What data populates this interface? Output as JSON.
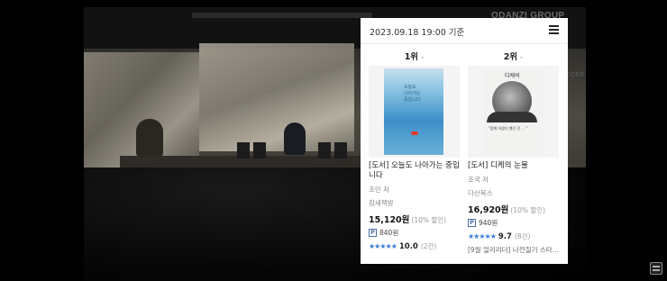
{
  "video": {
    "watermark": "ODANZI GROUP",
    "side_text": "ODER"
  },
  "panel": {
    "timestamp": "2023.09.18 19:00 기준",
    "menu_icon": "list-icon",
    "books": [
      {
        "rank": "1위",
        "rank_change": "-",
        "title": "[도서] 오늘도 나아가는 중입니다",
        "author": "조민 저",
        "publisher": "참새책방",
        "price": "15,120원",
        "discount": "(10% 할인)",
        "points": "840원",
        "rating": "10.0",
        "reviews": "(2건)",
        "cover_colors": [
          "#7fbcdf",
          "#3d8fc8"
        ]
      },
      {
        "rank": "2위",
        "rank_change": "-",
        "title": "[도서] 디케의 눈물",
        "author": "조국 저",
        "publisher": "다산북스",
        "price": "16,920원",
        "discount": "(10% 할인)",
        "points": "940원",
        "rating": "9.7",
        "reviews": "(8건)",
        "promo": "[9월 얼리리더] 나전칠기 스타...",
        "cover_title": "디케의",
        "cover_colors": [
          "#f2f2f0",
          "#333333"
        ]
      }
    ]
  },
  "accent_color": "#3a7bd5"
}
